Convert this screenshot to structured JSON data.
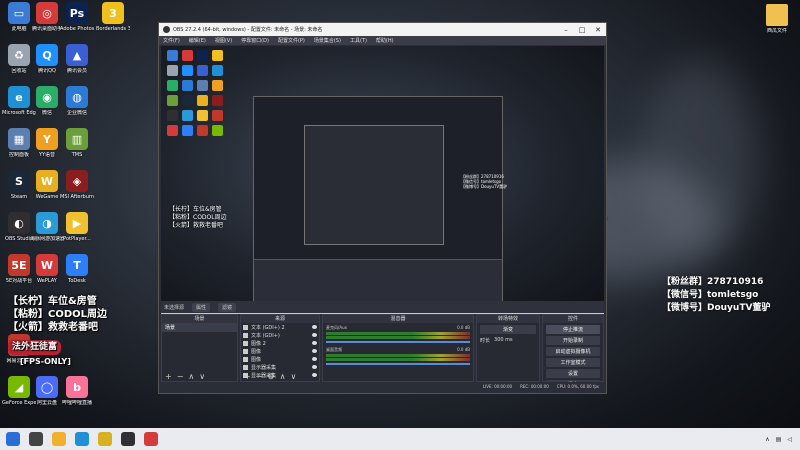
{
  "desktop": {
    "icons": [
      {
        "label": "此电脑",
        "color": "#3a7bd5",
        "glyph": "▭"
      },
      {
        "label": "腾讯桌面助手",
        "color": "#d63b3b",
        "glyph": "◎"
      },
      {
        "label": "Adobe Photosh...",
        "color": "#0c2350",
        "glyph": "Ps"
      },
      {
        "label": "Borderlands 3",
        "color": "#f0c020",
        "glyph": "3"
      },
      {
        "label": "回收站",
        "color": "#9aa3b0",
        "glyph": "♻"
      },
      {
        "label": "腾讯QQ",
        "color": "#1e90ff",
        "glyph": "Q"
      },
      {
        "label": "腾讯会员",
        "color": "#3a5fd5",
        "glyph": "▲"
      },
      {
        "label": "Microsoft Edge",
        "color": "#1f8fd6",
        "glyph": "e"
      },
      {
        "label": "微信",
        "color": "#2aae67",
        "glyph": "◉"
      },
      {
        "label": "企业微信",
        "color": "#2b7bd6",
        "glyph": "◍"
      },
      {
        "label": "控制面板",
        "color": "#5a7fb0",
        "glyph": "▦"
      },
      {
        "label": "YY语音",
        "color": "#f0a020",
        "glyph": "Y"
      },
      {
        "label": "TMS",
        "color": "#6b9f3a",
        "glyph": "▥"
      },
      {
        "label": "Steam",
        "color": "#1b2838",
        "glyph": "S"
      },
      {
        "label": "WeGame",
        "color": "#e8b020",
        "glyph": "W"
      },
      {
        "label": "MSI Afterburner",
        "color": "#8a1d1d",
        "glyph": "◈"
      },
      {
        "label": "OBS Studio",
        "color": "#302e31",
        "glyph": "◐"
      },
      {
        "label": "海豚网游加速器5.0",
        "color": "#2a9ad8",
        "glyph": "◑"
      },
      {
        "label": "PotPlayer...",
        "color": "#f0c030",
        "glyph": "▶"
      },
      {
        "label": "5E对战平台",
        "color": "#c0392b",
        "glyph": "5E"
      },
      {
        "label": "WePLAY",
        "color": "#d63b3b",
        "glyph": "W"
      },
      {
        "label": "ToDesk",
        "color": "#2d7ff9",
        "glyph": "T"
      },
      {
        "label": "网易云音乐",
        "color": "#c0392b",
        "glyph": "♫"
      },
      {
        "label": "GeForce Experience",
        "color": "#76b900",
        "glyph": "◢"
      },
      {
        "label": "阿里云盘",
        "color": "#4a6cf7",
        "glyph": "◯"
      },
      {
        "label": "哔哩哔哩直播",
        "color": "#fb7299",
        "glyph": "b"
      }
    ],
    "right_icon": {
      "label": "西瓜文件",
      "color": "#f0c050"
    }
  },
  "obs": {
    "title": "OBS 27.2.4 (64-bit, windows) - 配置文件: 未命名 - 场景: 未命名",
    "menu": [
      "文件(F)",
      "编辑(E)",
      "视图(V)",
      "停靠窗口(D)",
      "配置文件(P)",
      "场景集合(S)",
      "工具(T)",
      "帮助(H)"
    ],
    "dock_label": "未选择源",
    "dock_buttons": [
      "属性",
      "滤镜"
    ],
    "panels": {
      "scenes": {
        "header": "场景",
        "items": [
          "场景"
        ]
      },
      "sources": {
        "header": "来源",
        "items": [
          "文本 (GDI+) 2",
          "文本 (GDI+)",
          "图像 2",
          "图像",
          "图像",
          "显示器采集",
          "显示器采集"
        ]
      },
      "mixer": {
        "header": "混音器",
        "channels": [
          {
            "name": "麦克风/Aux",
            "db": "0.0 dB"
          },
          {
            "name": "桌面音频",
            "db": "0.0 dB"
          }
        ]
      },
      "transitions": {
        "header": "转场特效",
        "type": "渐变",
        "duration_label": "时长",
        "duration": "300 ms"
      },
      "controls": {
        "header": "控件",
        "buttons": [
          "停止推流",
          "开始录制",
          "启动虚拟摄像机",
          "工作室模式",
          "设置",
          "退出"
        ]
      }
    },
    "status": [
      "LIVE: 00:00:00",
      "REC: 00:00:00",
      "CPU: 0.0%, 60.00 fps"
    ]
  },
  "overlay": {
    "left_lines": [
      "【长柠】车位&房管",
      "【粘粉】CODOL周边",
      "【火箭】救救老番吧"
    ],
    "badge": "法外狂徒富",
    "fps": "[FPS-ONLY]"
  },
  "social": {
    "lines": [
      "【粉丝群】278710916",
      "【微信号】tomletsgo",
      "【微博号】DouyuTV董驴"
    ]
  },
  "taskbar": {
    "items": [
      {
        "name": "windows-start-icon",
        "color": "#2b6fd6"
      },
      {
        "name": "search-icon",
        "color": "#444"
      },
      {
        "name": "file-explorer-icon",
        "color": "#f0b030"
      },
      {
        "name": "edge-icon",
        "color": "#1f8fd6"
      },
      {
        "name": "borderlands-icon",
        "color": "#d8b020"
      },
      {
        "name": "obs-icon",
        "color": "#302e31"
      },
      {
        "name": "tencent-icon",
        "color": "#d63b3b"
      }
    ]
  }
}
